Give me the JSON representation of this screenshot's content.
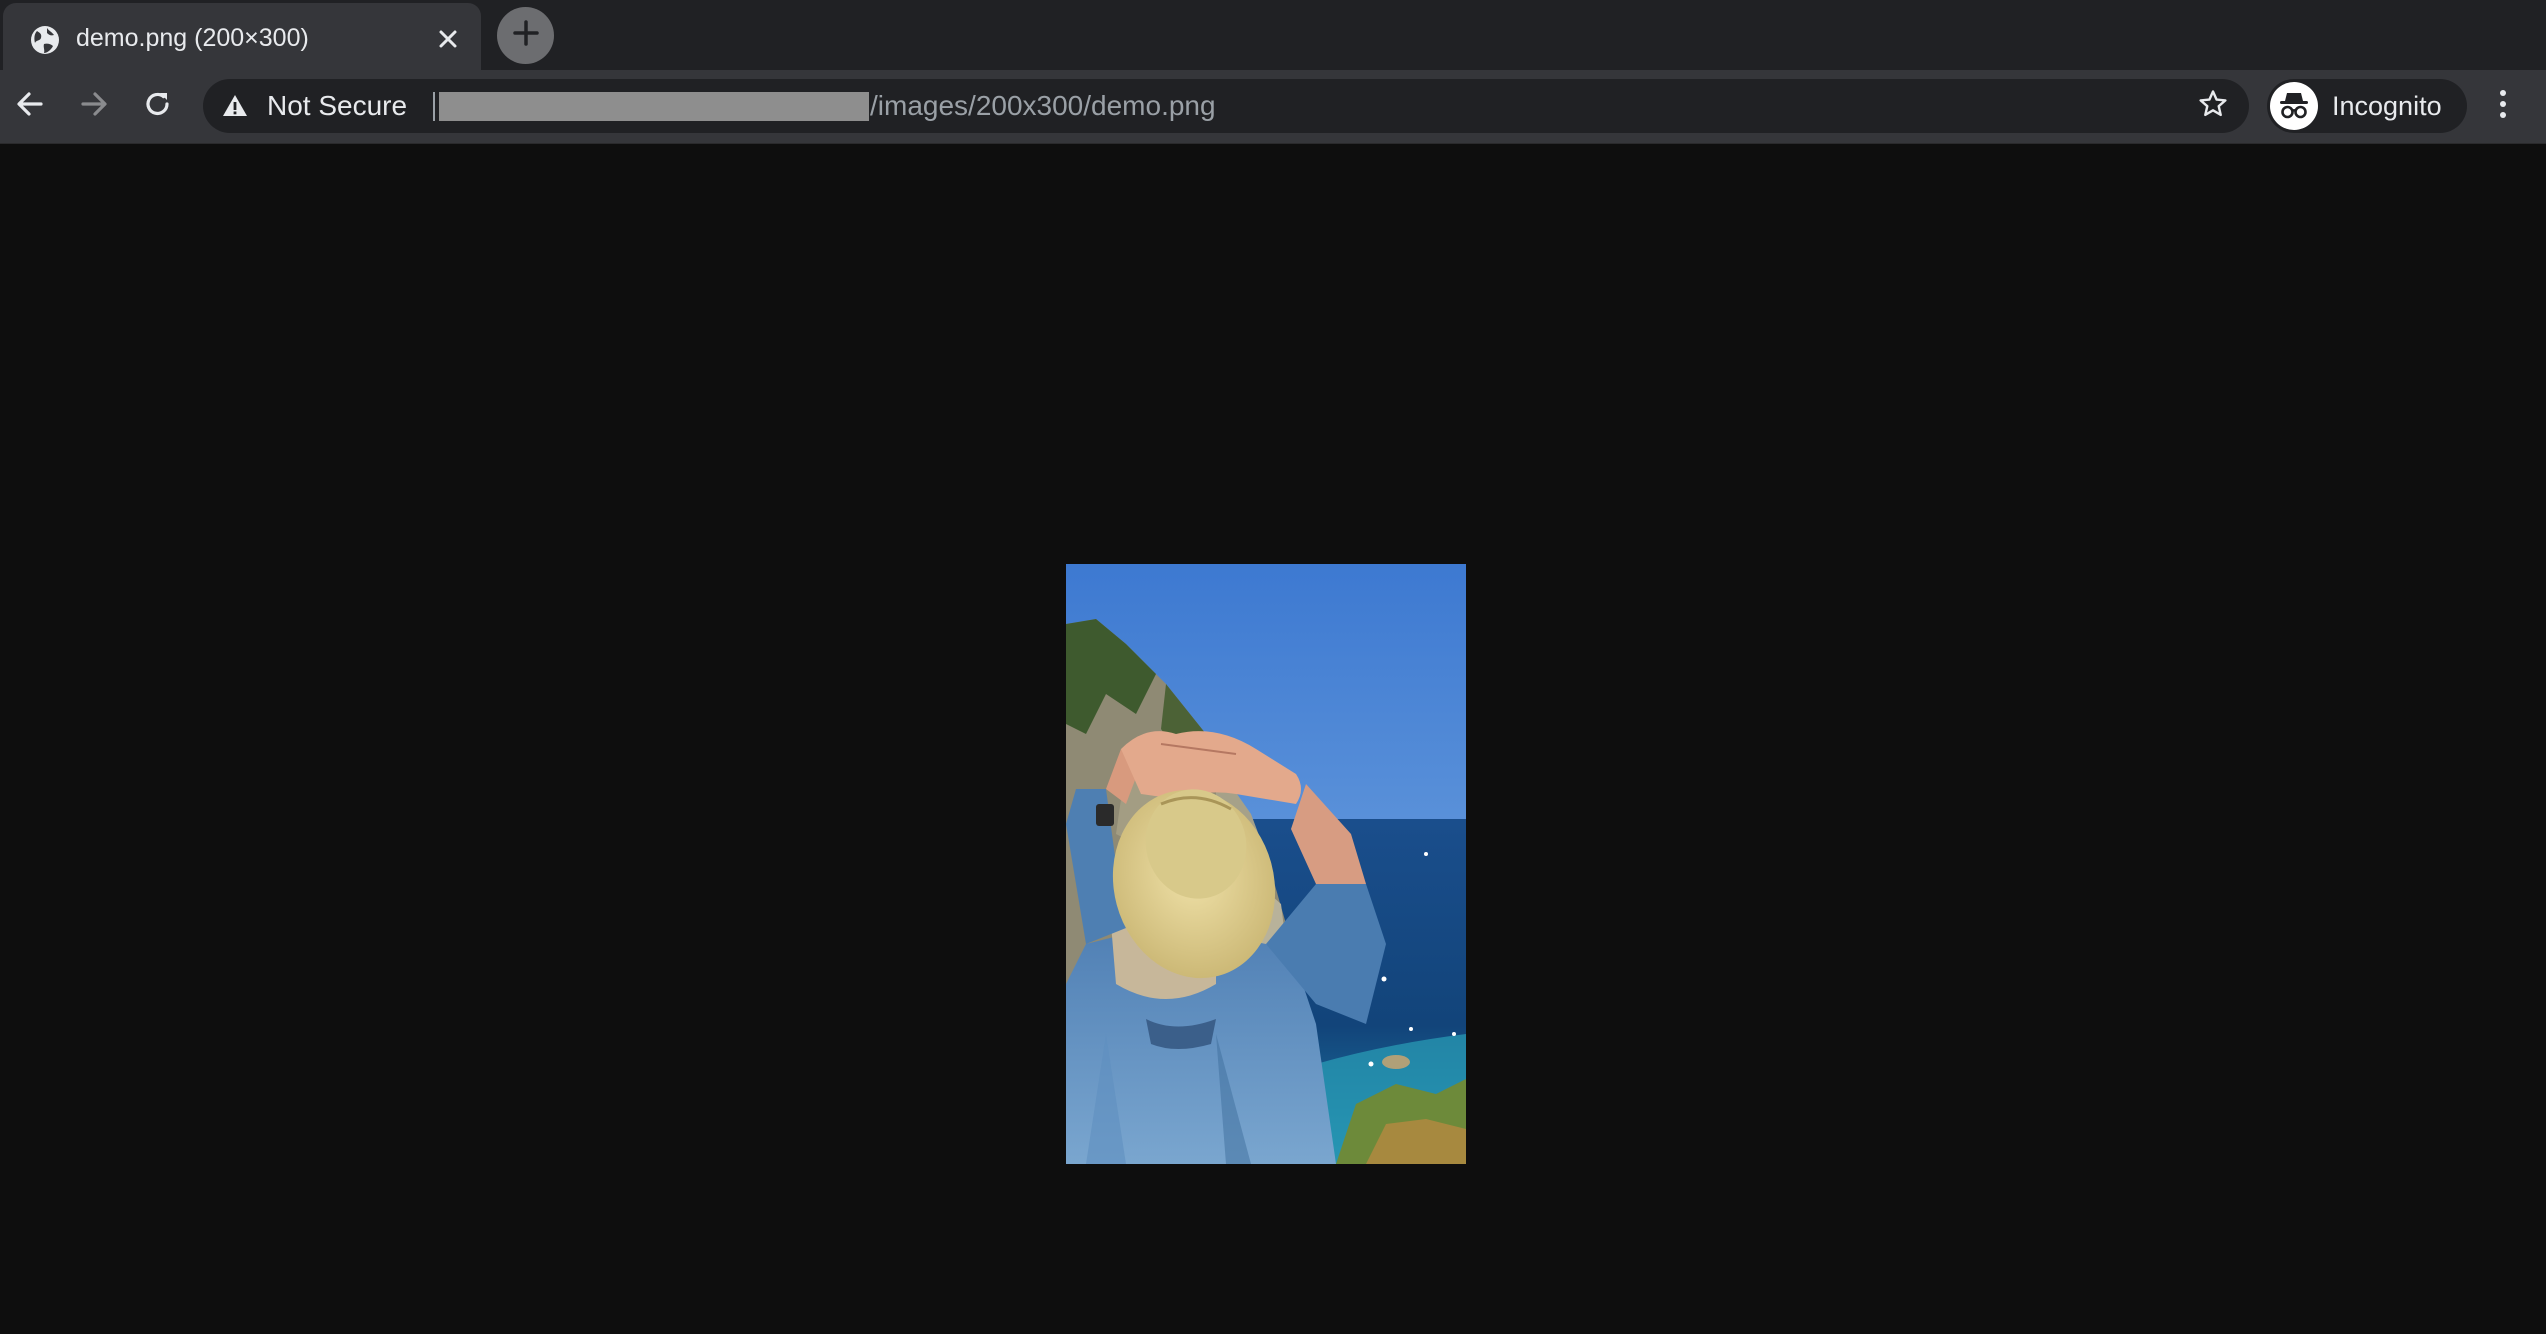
{
  "tab": {
    "title": "demo.png (200×300)",
    "favicon": "globe-icon",
    "close_icon": "close-icon"
  },
  "new_tab": {
    "icon": "plus-icon"
  },
  "toolbar": {
    "back_icon": "arrow-left-icon",
    "forward_icon": "arrow-right-icon",
    "reload_icon": "reload-icon",
    "security_icon": "warning-triangle-icon",
    "security_text": "Not Secure",
    "url_host_redacted": true,
    "url_path": "/images/200x300/demo.png",
    "bookmark_icon": "star-icon",
    "profile_icon": "incognito-icon",
    "profile_label": "Incognito",
    "menu_icon": "kebab-menu-icon"
  },
  "content": {
    "image_subject": "person in straw hat looking at sea and cliff",
    "image_width": 200,
    "image_height": 300
  },
  "colors": {
    "tab_strip": "#202124",
    "toolbar": "#35363a",
    "omnibox": "#202124",
    "page_bg": "#0e0e0e",
    "text": "#e8eaed",
    "url_muted": "#9aa0a6",
    "redaction": "#8e8e8e"
  }
}
